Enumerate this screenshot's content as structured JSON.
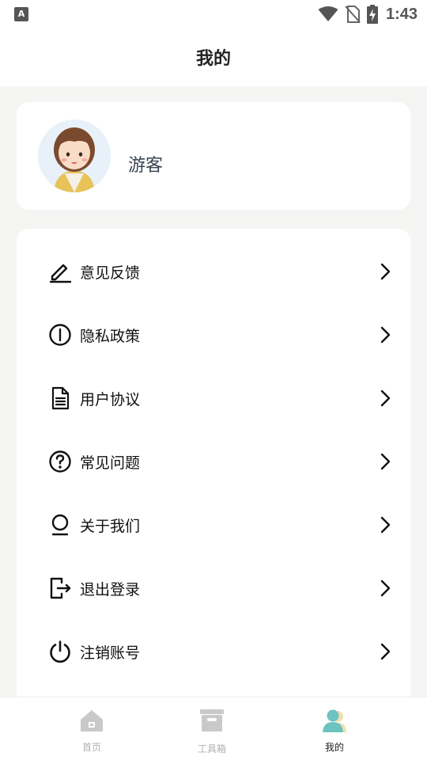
{
  "status_bar": {
    "app_badge": "A",
    "time": "1:43",
    "icons": [
      "wifi-icon",
      "no-sim-icon",
      "battery-charging-icon"
    ]
  },
  "header": {
    "title": "我的"
  },
  "profile": {
    "username": "游客"
  },
  "menu": {
    "items": [
      {
        "label": "意见反馈",
        "icon": "pen-icon"
      },
      {
        "label": "隐私政策",
        "icon": "info-circle-icon"
      },
      {
        "label": "用户协议",
        "icon": "document-icon"
      },
      {
        "label": "常见问题",
        "icon": "question-circle-icon"
      },
      {
        "label": "关于我们",
        "icon": "person-outline-icon"
      },
      {
        "label": "退出登录",
        "icon": "logout-icon"
      },
      {
        "label": "注销账号",
        "icon": "power-icon"
      }
    ]
  },
  "tab_bar": {
    "tabs": [
      {
        "label": "首页",
        "icon": "home-icon",
        "active": false
      },
      {
        "label": "工具箱",
        "icon": "toolbox-icon",
        "active": false
      },
      {
        "label": "我的",
        "icon": "profile-icon",
        "active": true
      }
    ]
  },
  "colors": {
    "background": "#f5f5f3",
    "card": "#ffffff",
    "tab_inactive": "#b0b0b0",
    "tab_active_icon": "#6cc3c0"
  }
}
